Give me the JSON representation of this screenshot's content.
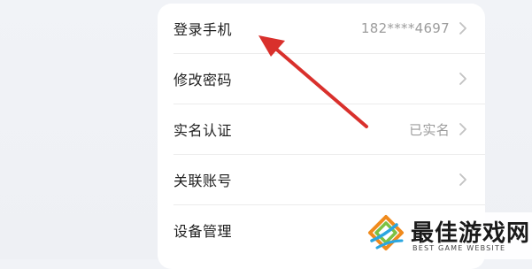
{
  "settings": {
    "items": [
      {
        "label": "登录手机",
        "value": "182****4697",
        "icon": "chevron-right-icon"
      },
      {
        "label": "修改密码",
        "value": "",
        "icon": "chevron-right-icon"
      },
      {
        "label": "实名认证",
        "value": "已实名",
        "icon": "chevron-right-icon"
      },
      {
        "label": "关联账号",
        "value": "",
        "icon": "chevron-right-icon"
      },
      {
        "label": "设备管理",
        "value": "",
        "icon": "chevron-right-icon"
      }
    ]
  },
  "annotation": {
    "arrow_color": "#d9302c",
    "icon": "red-arrow-pointer"
  },
  "watermark": {
    "title": "最佳游戏网",
    "subtitle": "BEST GAME WEBSITE",
    "logo_icon": "best-game-website-logo",
    "logo_colors": [
      "#f08a1c",
      "#7cc142",
      "#2aa6e0"
    ]
  },
  "colors": {
    "card_bg": "#ffffff",
    "page_bg": "#f0f2f6",
    "label_text": "#1f1f1f",
    "value_text": "#9c9c9c"
  }
}
